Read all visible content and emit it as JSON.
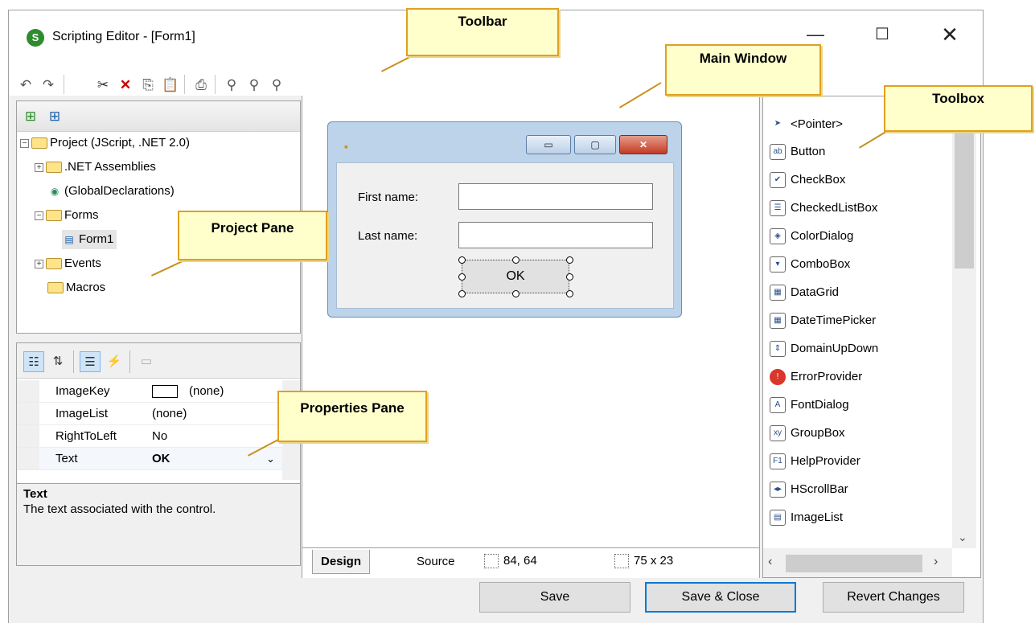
{
  "window": {
    "title": "Scripting Editor - [Form1]",
    "logo": "S",
    "controls": {
      "minimize": "—",
      "maximize": "☐",
      "close": "✕"
    }
  },
  "toolbar": {
    "buttons": [
      {
        "name": "undo-icon",
        "glyph": "↶"
      },
      {
        "name": "redo-icon",
        "glyph": "↷"
      },
      {
        "name": "cut-icon",
        "glyph": "✂"
      },
      {
        "name": "delete-icon",
        "glyph": "✕"
      },
      {
        "name": "copy-icon",
        "glyph": "⎘"
      },
      {
        "name": "paste-icon",
        "glyph": "📋"
      },
      {
        "name": "print-icon",
        "glyph": "⎙"
      },
      {
        "name": "find-icon",
        "glyph": "⚲"
      },
      {
        "name": "find-next-icon",
        "glyph": "⚲"
      },
      {
        "name": "replace-icon",
        "glyph": "⚲"
      }
    ]
  },
  "project_pane": {
    "toolbar_icons": [
      "add-project-icon",
      "add-form-icon"
    ],
    "tree": [
      {
        "label": "Project (JScript, .NET 2.0)",
        "toggle": "−",
        "icon": "folder-open",
        "level": 0
      },
      {
        "label": ".NET Assemblies",
        "toggle": "+",
        "icon": "folder",
        "level": 1
      },
      {
        "label": "(GlobalDeclarations)",
        "toggle": "",
        "icon": "globals",
        "level": 1
      },
      {
        "label": "Forms",
        "toggle": "−",
        "icon": "folder-open",
        "level": 1
      },
      {
        "label": "Form1",
        "toggle": "",
        "icon": "form",
        "level": 2,
        "selected": true
      },
      {
        "label": "Events",
        "toggle": "+",
        "icon": "folder",
        "level": 1
      },
      {
        "label": "Macros",
        "toggle": "",
        "icon": "folder",
        "level": 1
      }
    ]
  },
  "properties_pane": {
    "rows": [
      {
        "name": "ImageKey",
        "value": "(none)",
        "swatch": true
      },
      {
        "name": "ImageList",
        "value": "(none)"
      },
      {
        "name": "RightToLeft",
        "value": "No"
      },
      {
        "name": "Text",
        "value": "OK",
        "bold": true
      }
    ],
    "description_title": "Text",
    "description_text": "The text associated with the control."
  },
  "designer": {
    "form": {
      "first_name_label": "First name:",
      "last_name_label": "Last name:",
      "ok_button": "OK",
      "min_glyph": "▭",
      "max_glyph": "▢",
      "close_glyph": "✕"
    },
    "tabs": [
      "Design",
      "Source"
    ],
    "active_tab": "Design",
    "position": "84, 64",
    "size": "75 x 23"
  },
  "toolbox": {
    "items": [
      {
        "label": "<Pointer>",
        "icon": "pointer-icon",
        "glyph": "➤"
      },
      {
        "label": "Button",
        "icon": "button-icon",
        "glyph": "ab"
      },
      {
        "label": "CheckBox",
        "icon": "checkbox-icon",
        "glyph": "✔"
      },
      {
        "label": "CheckedListBox",
        "icon": "checkedlistbox-icon",
        "glyph": "☰"
      },
      {
        "label": "ColorDialog",
        "icon": "colordialog-icon",
        "glyph": "◈"
      },
      {
        "label": "ComboBox",
        "icon": "combobox-icon",
        "glyph": "▾"
      },
      {
        "label": "DataGrid",
        "icon": "datagrid-icon",
        "glyph": "▦"
      },
      {
        "label": "DateTimePicker",
        "icon": "datetimepicker-icon",
        "glyph": "▦"
      },
      {
        "label": "DomainUpDown",
        "icon": "domainupdown-icon",
        "glyph": "⇕"
      },
      {
        "label": "ErrorProvider",
        "icon": "errorprovider-icon",
        "glyph": "!"
      },
      {
        "label": "FontDialog",
        "icon": "fontdialog-icon",
        "glyph": "A"
      },
      {
        "label": "GroupBox",
        "icon": "groupbox-icon",
        "glyph": "xy"
      },
      {
        "label": "HelpProvider",
        "icon": "helpprovider-icon",
        "glyph": "F1"
      },
      {
        "label": "HScrollBar",
        "icon": "hscrollbar-icon",
        "glyph": "◂▸"
      },
      {
        "label": "ImageList",
        "icon": "imagelist-icon",
        "glyph": "▤"
      }
    ]
  },
  "buttons": {
    "save": "Save",
    "save_close": "Save & Close",
    "revert": "Revert Changes"
  },
  "callouts": {
    "toolbar": "Toolbar",
    "main_window": "Main Window",
    "toolbox": "Toolbox",
    "project_pane": "Project Pane",
    "properties_pane": "Properties Pane"
  }
}
